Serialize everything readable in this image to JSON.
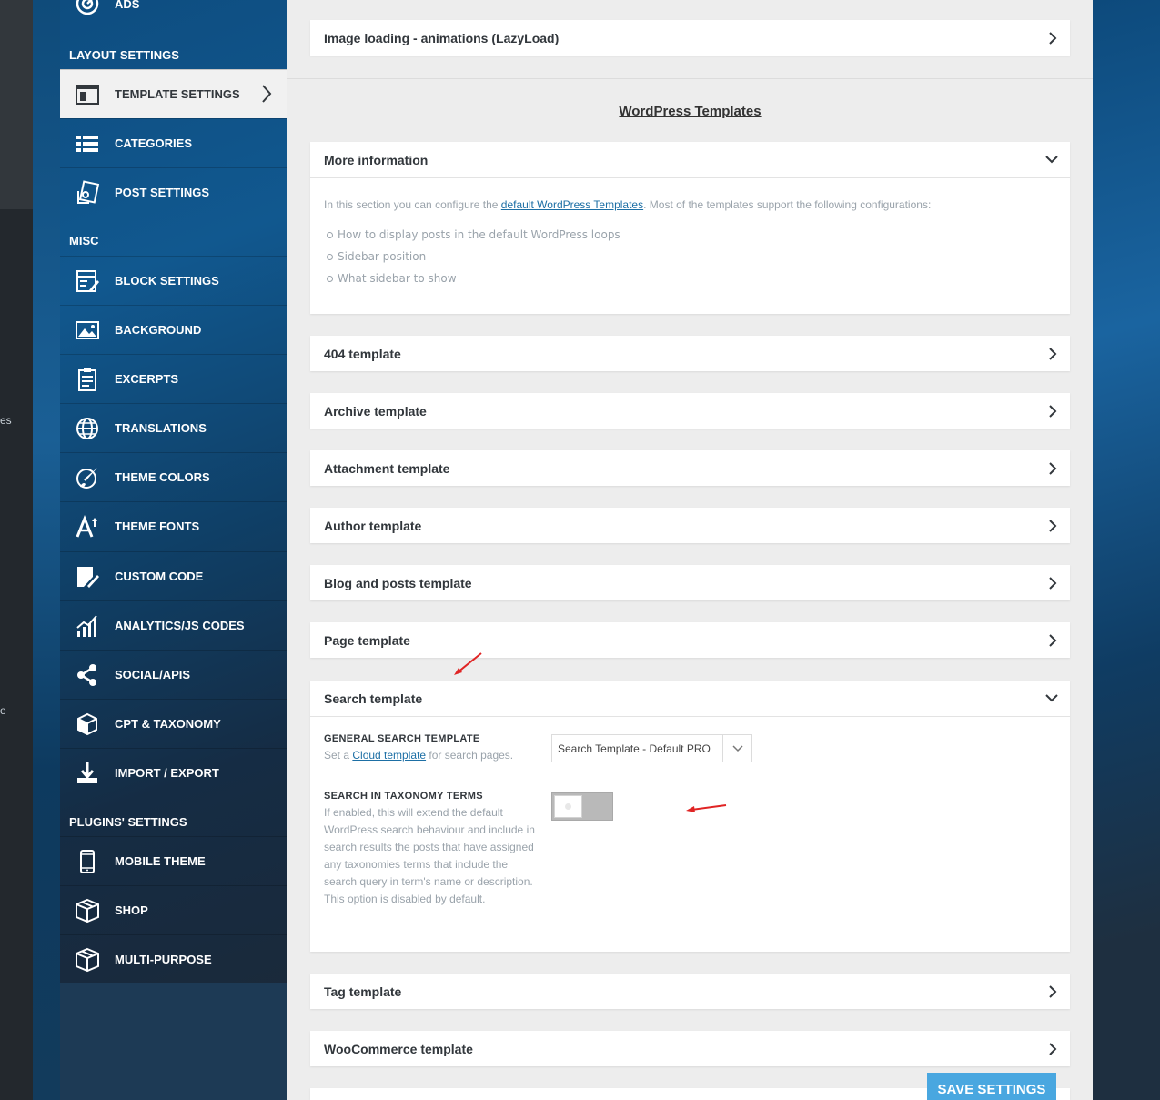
{
  "wp_menu_fragments": [
    "es",
    "e"
  ],
  "sidebar": {
    "ads_label": "ADS",
    "sections": {
      "layout": "LAYOUT SETTINGS",
      "misc": "MISC",
      "plugins": "PLUGINS' SETTINGS"
    },
    "layout_items": [
      {
        "label": "TEMPLATE SETTINGS",
        "icon": "template-icon",
        "active": true
      },
      {
        "label": "CATEGORIES",
        "icon": "list-icon"
      },
      {
        "label": "POST SETTINGS",
        "icon": "post-icon"
      }
    ],
    "misc_items": [
      {
        "label": "BLOCK SETTINGS",
        "icon": "block-icon"
      },
      {
        "label": "BACKGROUND",
        "icon": "image-icon"
      },
      {
        "label": "EXCERPTS",
        "icon": "clipboard-icon"
      },
      {
        "label": "TRANSLATIONS",
        "icon": "globe-icon"
      },
      {
        "label": "THEME COLORS",
        "icon": "brush-icon"
      },
      {
        "label": "THEME FONTS",
        "icon": "font-icon"
      },
      {
        "label": "CUSTOM CODE",
        "icon": "code-icon"
      },
      {
        "label": "ANALYTICS/JS CODES",
        "icon": "analytics-icon"
      },
      {
        "label": "SOCIAL/APIS",
        "icon": "share-icon"
      },
      {
        "label": "CPT & TAXONOMY",
        "icon": "cube-icon"
      },
      {
        "label": "IMPORT / EXPORT",
        "icon": "download-icon"
      }
    ],
    "plugin_items": [
      {
        "label": "MOBILE THEME",
        "icon": "mobile-icon"
      },
      {
        "label": "SHOP",
        "icon": "box-icon"
      },
      {
        "label": "MULTI-PURPOSE",
        "icon": "box-icon"
      }
    ]
  },
  "main": {
    "lazyload_panel": "Image loading - animations (LazyLoad)",
    "section_title": "WordPress Templates",
    "more_info": {
      "title": "More information",
      "text_before": "In this section you can configure the ",
      "link": "default WordPress Templates",
      "text_after": ". Most of the templates support the following configurations:",
      "bullets": [
        "How to display posts in the default WordPress loops",
        "Sidebar position",
        "What sidebar to show"
      ]
    },
    "templates": {
      "t404": "404 template",
      "archive": "Archive template",
      "attachment": "Attachment template",
      "author": "Author template",
      "blog": "Blog and posts template",
      "page": "Page template",
      "search": "Search template",
      "tag": "Tag template",
      "woocommerce": "WooCommerce template"
    },
    "search": {
      "general_label": "GENERAL SEARCH TEMPLATE",
      "general_desc_before": "Set a ",
      "general_desc_link": "Cloud template",
      "general_desc_after": " for search pages.",
      "select_value": "Search Template - Default PRO",
      "taxonomy_label": "SEARCH IN TAXONOMY TERMS",
      "taxonomy_desc": "If enabled, this will extend the default WordPress search behaviour and include in search results the posts that have assigned any taxonomies terms that include the search query in term's name or description. This option is disabled by default.",
      "taxonomy_enabled": false
    },
    "save_button": "SAVE SETTINGS"
  },
  "colors": {
    "accent_button": "#49a7e0",
    "annotation_arrow": "#e02424",
    "link": "#1d6fa5"
  }
}
